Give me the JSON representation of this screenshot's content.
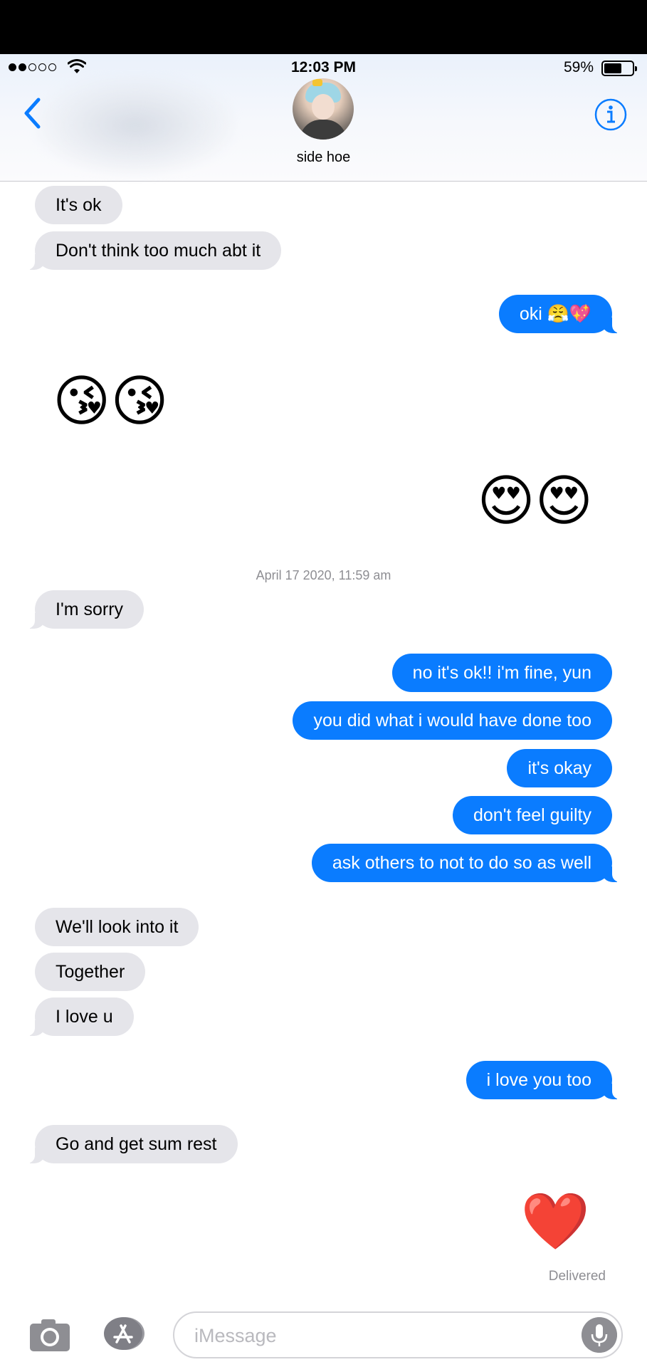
{
  "status_bar": {
    "time": "12:03 PM",
    "battery_percent": "59%",
    "battery_level": 0.59,
    "signal_bars_filled": 2,
    "signal_bars_total": 5
  },
  "header": {
    "contact_name": "side hoe",
    "back_icon": "chevron-left-icon",
    "info_icon": "info-icon",
    "accent_color": "#0a7cff"
  },
  "messages": {
    "m1": "It's ok",
    "m2": "Don't think too much abt it",
    "m3": "oki 😤💖",
    "m4": "😘😘",
    "m5": "😍😍",
    "timestamp": "April 17 2020, 11:59 am",
    "m6": "I'm sorry",
    "m7": "no it's ok!! i'm fine, yun",
    "m8": "you did what i would have done too",
    "m9": "it's okay",
    "m10": "don't feel guilty",
    "m11": "ask others to not to do so as well",
    "m12": "We'll look into it",
    "m13": "Together",
    "m14": "I love u",
    "m15": "i love you too",
    "m16": "Go and get sum rest",
    "m17": "❤️",
    "delivered": "Delivered"
  },
  "input_bar": {
    "placeholder": "iMessage",
    "camera_icon": "camera-icon",
    "appstore_icon": "app-store-icon",
    "mic_icon": "microphone-icon"
  },
  "colors": {
    "sent_bubble": "#0a7cff",
    "received_bubble": "#e5e5ea"
  }
}
